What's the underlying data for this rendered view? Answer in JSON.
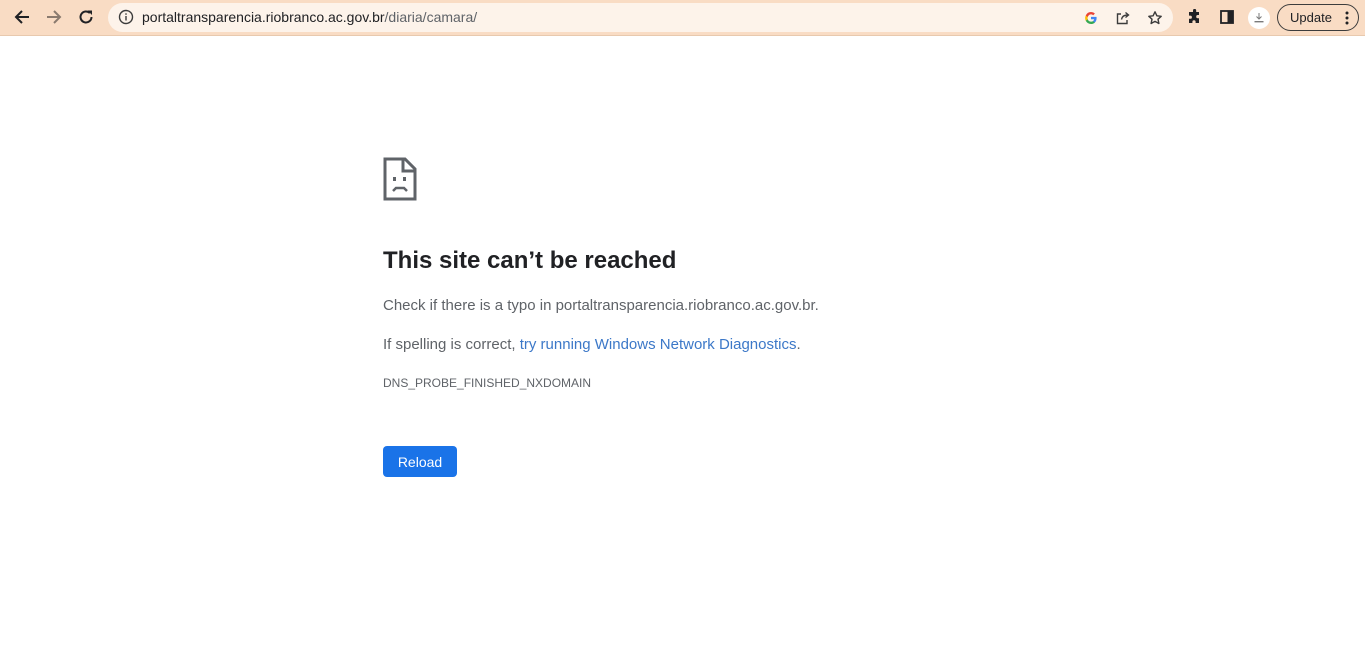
{
  "browser": {
    "url_host": "portaltransparencia.riobranco.ac.gov.br",
    "url_path": "/diaria/camara/",
    "update_label": "Update",
    "icons": {
      "back": "arrow-left-icon",
      "forward": "arrow-right-icon",
      "reload": "reload-icon",
      "site_info": "info-icon",
      "google": "google-icon",
      "share": "share-icon",
      "bookmark": "star-icon",
      "extensions": "puzzle-icon",
      "side_panel": "side-panel-icon",
      "profile": "avatar-icon",
      "menu": "kebab-menu-icon"
    }
  },
  "error_page": {
    "icon": "sad-page-icon",
    "title": "This site can’t be reached",
    "check_prefix": "Check if there is a typo in ",
    "check_host": "portaltransparencia.riobranco.ac.gov.br",
    "check_suffix": ".",
    "spelling_prefix": "If spelling is correct, ",
    "spelling_link": "try running Windows Network Diagnostics",
    "spelling_suffix": ".",
    "error_code": "DNS_PROBE_FINISHED_NXDOMAIN",
    "reload_label": "Reload"
  },
  "colors": {
    "toolbar_bg": "#f9dcc4",
    "link": "#3c78c8",
    "button_bg": "#1a73e8"
  }
}
